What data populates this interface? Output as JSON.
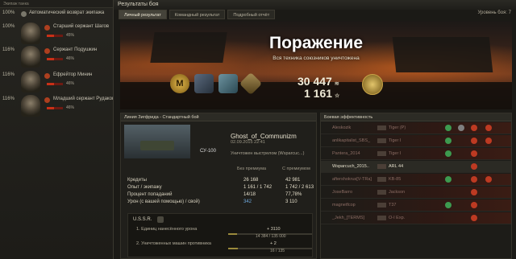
{
  "crew_panel": {
    "header": "Экипаж танка",
    "members": [
      {
        "percent": "100%",
        "name": "Автоматический возврат экипажа",
        "skill_level": ""
      },
      {
        "percent": "100%",
        "name": "Старший сержант Шагов",
        "skill_level": "45%"
      },
      {
        "percent": "116%",
        "name": "Сержант Подушкин",
        "skill_level": "46%"
      },
      {
        "percent": "116%",
        "name": "Ефрейтор Минин",
        "skill_level": "46%"
      },
      {
        "percent": "116%",
        "name": "Младший сержант Рудаковс",
        "skill_level": "46%"
      }
    ]
  },
  "window": {
    "title": "Результаты боя",
    "level": "Уровень боя: 7",
    "tabs": [
      {
        "label": "Личный результат",
        "active": true
      },
      {
        "label": "Командный результат",
        "active": false
      },
      {
        "label": "Подробный отчёт",
        "active": false
      }
    ]
  },
  "banner": {
    "result": "Поражение",
    "subtitle": "Вся техника союзников уничтожена",
    "credits": "30 447",
    "xp": "1 161",
    "medals": [
      "medal-m-icon",
      "medal-hammer-icon",
      "medal-shield-icon",
      "medal-rhombus-icon"
    ]
  },
  "personal": {
    "map": "Линия Зигфрида - Стандартный бой",
    "player": "Ghost_of_Communizm",
    "date": "02.09.2015 22:41",
    "tank": "СУ-100",
    "killed": "Уничтожен выстрелом (Wsparcuc...)",
    "col_no_premium": "Без премиума",
    "col_premium": "С премиумом",
    "rows": [
      {
        "label": "Кредиты",
        "no_premium": "26 168",
        "premium": "42 981"
      },
      {
        "label": "Опыт / экипажу",
        "no_premium": "1 161 / 1 742",
        "premium": "1 742 / 2 613"
      },
      {
        "label": "Процент попаданий",
        "no_premium": "14/18",
        "premium": "77,78%"
      },
      {
        "label": "Урон (с вашей помощью) / свой)",
        "no_premium": "342",
        "premium": "3 110"
      }
    ],
    "ussr": {
      "title": "U.S.S.R.",
      "task1": "1. Единиц нанесённого урона",
      "task1_value": "+ 3110",
      "task1_progress": "14 384 / 135 000",
      "task2": "2. Уничтоженных машин противника",
      "task2_value": "+ 2",
      "task2_progress": "16 / 135"
    }
  },
  "efficiency": {
    "title": "Боевая эффективность",
    "rows": [
      {
        "player": "Aleskozik",
        "tank": "Tiger (P)",
        "alive": false
      },
      {
        "player": "anlikapitalist_SBS_",
        "tank": "Tiger I",
        "alive": false
      },
      {
        "player": "Pantera_2014",
        "tank": "Tiger I",
        "alive": false
      },
      {
        "player": "Wsparcuch_2015..",
        "tank": "ARL 44",
        "alive": true
      },
      {
        "player": "aftershokrus[V-TRa]",
        "tank": "KB-85",
        "alive": false
      },
      {
        "player": "JoseBarro",
        "tank": "Jackson",
        "alive": false
      },
      {
        "player": "magnetfcop",
        "tank": "T37",
        "alive": false
      },
      {
        "player": "_Jekh_[TERMS]",
        "tank": "О-I Exp.",
        "alive": false
      }
    ]
  }
}
